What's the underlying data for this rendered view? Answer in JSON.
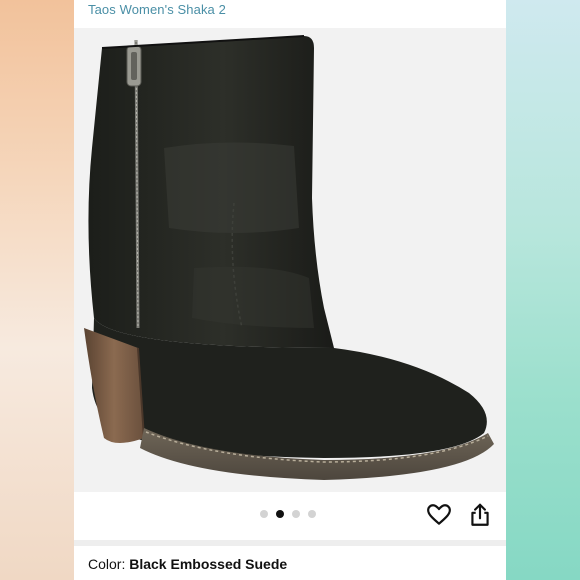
{
  "product": {
    "title": "Taos Women's Shaka 2",
    "image_alt": "Black ankle boot with side zipper and stacked wooden heel"
  },
  "carousel": {
    "dot_count": 4,
    "active_index": 1
  },
  "actions": {
    "favorite_icon": "heart-icon",
    "share_icon": "share-icon"
  },
  "variant": {
    "color_label": "Color:",
    "color_value": "Black Embossed Suede"
  },
  "colors": {
    "title_link": "#4a8fa6",
    "dot_active": "#111111",
    "dot_inactive": "#d3d3d3"
  }
}
